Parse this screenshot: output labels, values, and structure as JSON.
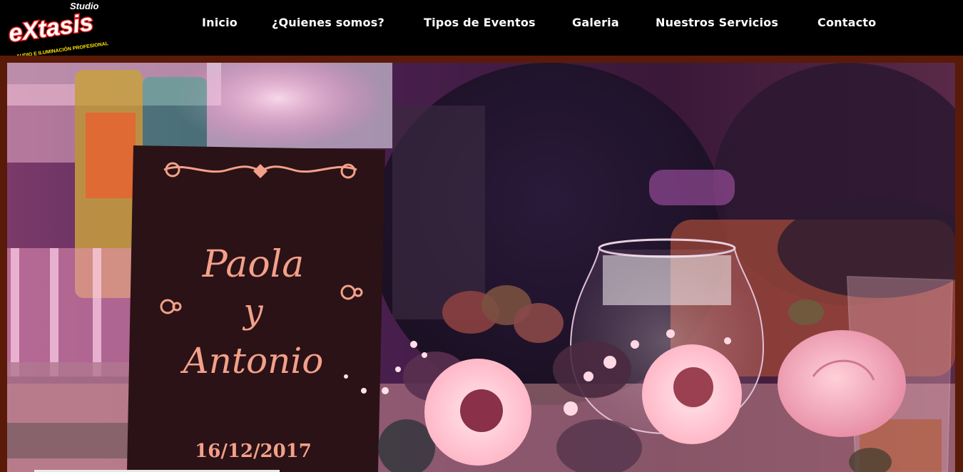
{
  "logo": {
    "small": "Studio",
    "brand": "eXtasis",
    "tagline": "AUDIO E ILUMINACIÓN PROFESIONAL"
  },
  "nav": {
    "items": [
      {
        "label": "Inicio"
      },
      {
        "label": "¿Quienes somos?"
      },
      {
        "label": "Tipos de Eventos"
      },
      {
        "label": "Galeria"
      },
      {
        "label": "Nuestros Servicios"
      },
      {
        "label": "Contacto"
      }
    ]
  },
  "hero": {
    "card": {
      "name1": "Paola",
      "conj": "y",
      "name2": "Antonio",
      "date": "16/12/2017"
    }
  },
  "colors": {
    "frame": "#5a1a08",
    "card": "#2a1216",
    "card_text": "#f3a08a"
  }
}
